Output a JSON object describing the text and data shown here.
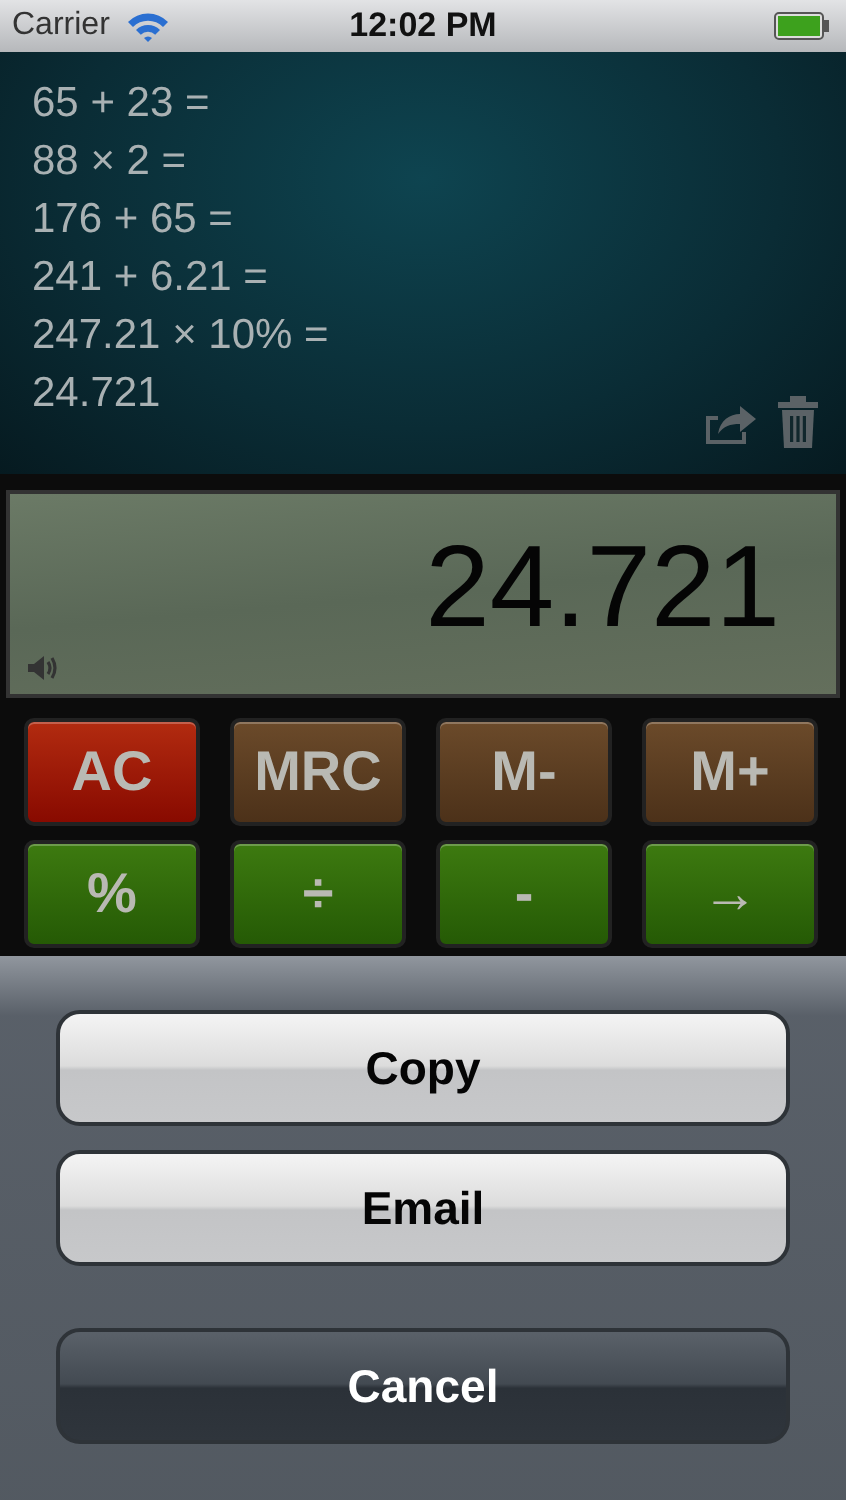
{
  "status_bar": {
    "carrier": "Carrier",
    "time": "12:02 PM"
  },
  "tape": {
    "lines": [
      "65 + 23 =",
      "88 × 2 =",
      "176 + 65 =",
      "241 + 6.21 =",
      "247.21 × 10% =",
      "24.721"
    ]
  },
  "display": {
    "value": "24.721",
    "sound_on": true
  },
  "keys": [
    {
      "label": "AC",
      "kind": "clear"
    },
    {
      "label": "MRC",
      "kind": "memory"
    },
    {
      "label": "M-",
      "kind": "memory"
    },
    {
      "label": "M+",
      "kind": "memory"
    },
    {
      "label": "%",
      "kind": "operator"
    },
    {
      "label": "÷",
      "kind": "operator"
    },
    {
      "label": "-",
      "kind": "operator"
    },
    {
      "label": "→",
      "kind": "operator"
    }
  ],
  "action_sheet": {
    "buttons": [
      {
        "label": "Copy",
        "kind": "default"
      },
      {
        "label": "Email",
        "kind": "default"
      },
      {
        "label": "Cancel",
        "kind": "cancel"
      }
    ]
  }
}
